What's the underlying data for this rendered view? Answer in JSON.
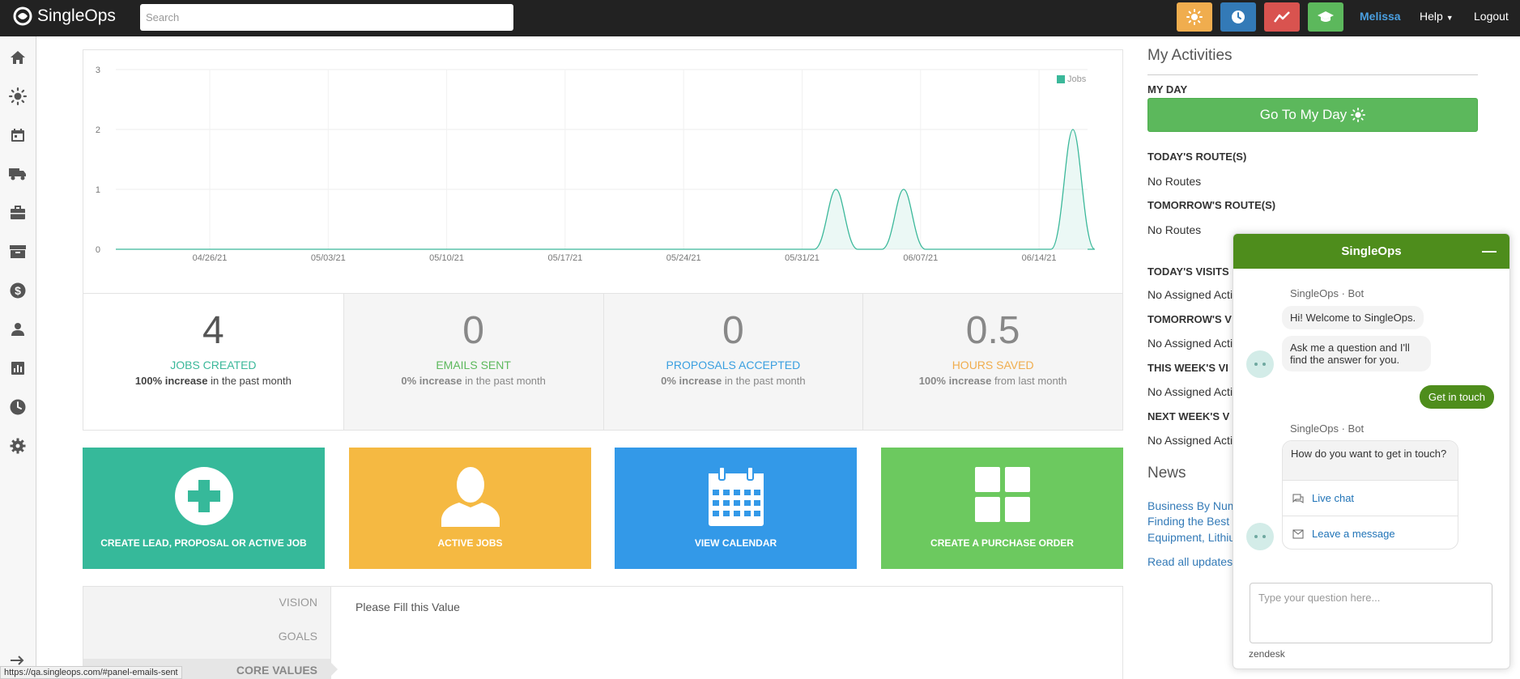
{
  "header": {
    "logo_text": "SingleOps",
    "search_placeholder": "Search",
    "buttons": [
      {
        "icon": "sun-icon",
        "color": "#f0ad4e"
      },
      {
        "icon": "clock-icon",
        "color": "#337ab7"
      },
      {
        "icon": "chart-line-icon",
        "color": "#d9534f"
      },
      {
        "icon": "graduation-cap-icon",
        "color": "#5cb85c"
      }
    ],
    "user_name": "Melissa",
    "help_label": "Help",
    "logout_label": "Logout"
  },
  "sidebar": {
    "items": [
      {
        "icon": "home-icon"
      },
      {
        "icon": "sun-icon"
      },
      {
        "icon": "calendar-icon"
      },
      {
        "icon": "truck-icon"
      },
      {
        "icon": "briefcase-icon"
      },
      {
        "icon": "archive-icon"
      },
      {
        "icon": "dollar-icon"
      },
      {
        "icon": "user-icon"
      },
      {
        "icon": "bar-chart-icon"
      },
      {
        "icon": "clock-icon"
      },
      {
        "icon": "gear-icon"
      }
    ],
    "collapse_icon": "arrow-right-icon"
  },
  "chart_data": {
    "type": "area",
    "series": [
      {
        "name": "Jobs",
        "color": "#3bb89a"
      }
    ],
    "x_ticks": [
      "04/26/21",
      "05/03/21",
      "05/10/21",
      "05/17/21",
      "05/24/21",
      "05/31/21",
      "06/07/21",
      "06/14/21"
    ],
    "y_ticks": [
      0,
      1,
      2,
      3
    ],
    "ylim": [
      0,
      3
    ],
    "peaks": [
      {
        "date": "06/02/21",
        "value": 1
      },
      {
        "date": "06/06/21",
        "value": 1
      },
      {
        "date": "06/16/21",
        "value": 2
      }
    ],
    "grid": true,
    "legend": "top-right"
  },
  "stats": [
    {
      "value": "4",
      "label": "JOBS CREATED",
      "change": "100% increase",
      "period": " in the past month",
      "color": "#3bb89a"
    },
    {
      "value": "0",
      "label": "EMAILS SENT",
      "change": "0% increase",
      "period": " in the past month",
      "color": "#5cb85c"
    },
    {
      "value": "0",
      "label": "PROPOSALS ACCEPTED",
      "change": "0% increase",
      "period": " in the past month",
      "color": "#3a9fe0"
    },
    {
      "value": "0.5",
      "label": "HOURS SAVED",
      "change": "100% increase",
      "period": " from last month",
      "color": "#f0ad4e"
    }
  ],
  "tiles": [
    {
      "label": "CREATE LEAD, PROPOSAL OR ACTIVE JOB",
      "icon": "plus-circle-icon",
      "color": "#36b99a"
    },
    {
      "label": "ACTIVE JOBS",
      "icon": "user-silhouette-icon",
      "color": "#f5b942"
    },
    {
      "label": "VIEW CALENDAR",
      "icon": "calendar-icon",
      "color": "#3399e8"
    },
    {
      "label": "CREATE A PURCHASE ORDER",
      "icon": "grid-icon",
      "color": "#6cc95f"
    }
  ],
  "bottom": {
    "tabs": [
      "VISION",
      "GOALS",
      "CORE VALUES"
    ],
    "active_tab": "CORE VALUES",
    "content": "Please Fill this Value"
  },
  "status_url": "https://qa.singleops.com/#panel-emails-sent",
  "activities": {
    "title": "My Activities",
    "my_day_heading": "MY DAY",
    "my_day_button": "Go To My Day",
    "sections": [
      {
        "heading": "TODAY'S ROUTE(S)",
        "value": "No Routes"
      },
      {
        "heading": "TOMORROW'S ROUTE(S)",
        "value": "No Routes"
      },
      {
        "heading": "TODAY'S VISITS",
        "value": "No Assigned Acti"
      },
      {
        "heading": "TOMORROW'S V",
        "value": "No Assigned Acti"
      },
      {
        "heading": "THIS WEEK'S VI",
        "value": "No Assigned Acti"
      },
      {
        "heading": "NEXT WEEK'S V",
        "value": "No Assigned Acti"
      }
    ]
  },
  "news": {
    "title": "News",
    "links": [
      "Business By Num",
      "Finding the Best",
      "Equipment, Lithiu"
    ],
    "read_all": "Read all updates"
  },
  "chat": {
    "title": "SingleOps",
    "minimize_label": "—",
    "sender": "SingleOps",
    "sender_role": "Bot",
    "msg_welcome": "Hi! Welcome to SingleOps.",
    "msg_ask": "Ask me a question and I'll find the answer for you.",
    "get_in_touch": "Get in touch",
    "msg_how": "How do you want to get in touch?",
    "option_live_chat": "Live chat",
    "option_message": "Leave a message",
    "input_placeholder": "Type your question here...",
    "footer": "zendesk"
  }
}
